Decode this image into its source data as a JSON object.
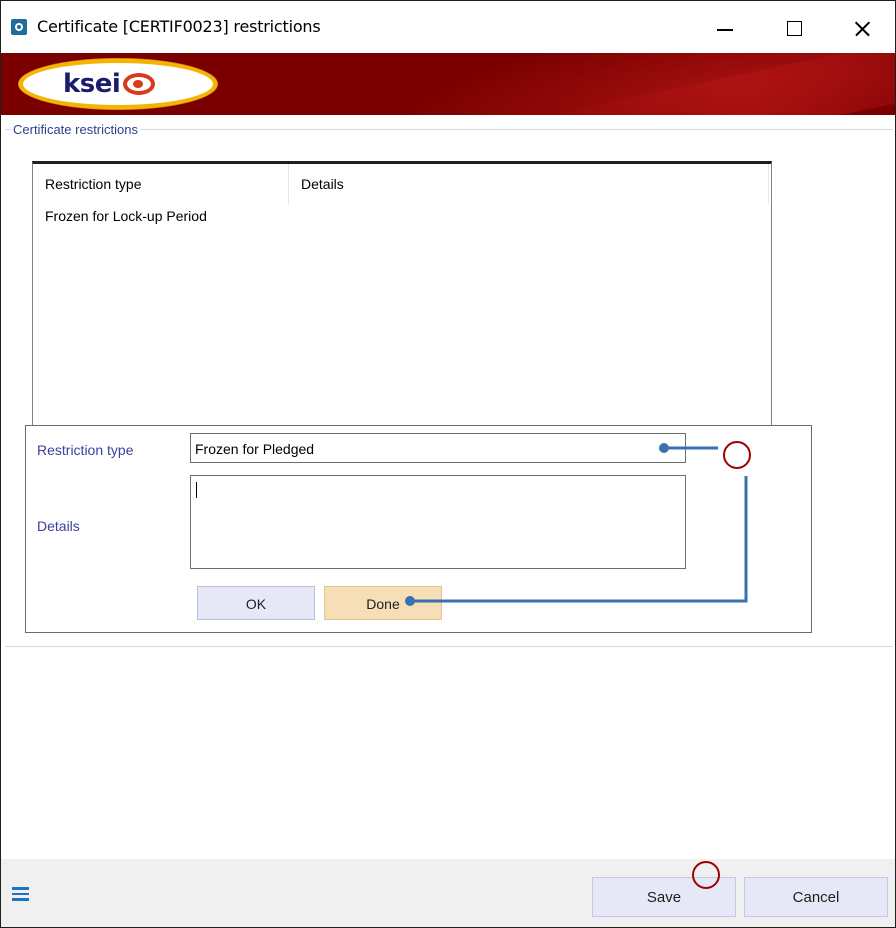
{
  "window": {
    "title": "Certificate [CERTIF0023] restrictions"
  },
  "banner": {
    "logo_text": "ksei"
  },
  "group": {
    "label": "Certificate restrictions"
  },
  "list": {
    "columns": [
      "Restriction type",
      "Details"
    ],
    "rows": [
      {
        "restriction_type": "Frozen for Lock-up Period",
        "details": ""
      }
    ]
  },
  "editor": {
    "restriction_type_label": "Restriction type",
    "restriction_type_value": "Frozen for Pledged",
    "details_label": "Details",
    "details_value": "",
    "ok_label": "OK",
    "done_label": "Done"
  },
  "footer": {
    "save_label": "Save",
    "cancel_label": "Cancel"
  },
  "icons": {
    "app": "app-icon",
    "menu": "hamburger-menu-icon",
    "minimize": "minimize-icon",
    "maximize": "maximize-icon",
    "close": "close-icon"
  },
  "colors": {
    "banner": "#7a0000",
    "label": "#3b3f9e",
    "button": "#e6e8f7",
    "done_button": "#f6dfb7",
    "annotation_line": "#3a6fb0",
    "annotation_circle": "#a00000",
    "menu_icon": "#1a73c9"
  }
}
